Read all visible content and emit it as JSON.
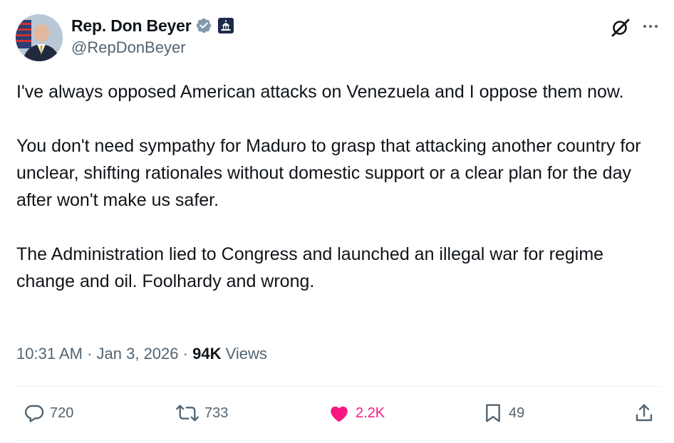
{
  "author": {
    "display_name": "Rep. Don Beyer",
    "handle": "@RepDonBeyer",
    "verified_badge_icon": "verified-badge-icon",
    "government_badge_icon": "capitol-building-icon",
    "verified_color": "#829aab"
  },
  "tweet": {
    "paragraphs": [
      "I've always opposed American attacks on Venezuela and I oppose them now.",
      "You don't need sympathy for Maduro to grasp that attacking another country for unclear, shifting rationales without domestic support or a clear plan for the day after won't make us safer.",
      "The Administration lied to Congress and launched an illegal war for regime change and oil. Foolhardy and wrong."
    ],
    "time": "10:31 AM",
    "separator": "·",
    "date": "Jan 3, 2026",
    "views_count": "94K",
    "views_label": "Views"
  },
  "actions": {
    "replies": "720",
    "reposts": "733",
    "likes": "2.2K",
    "bookmarks": "49"
  },
  "icons": {
    "grok": "grok-icon",
    "more": "more-icon",
    "reply": "reply-icon",
    "repost": "repost-icon",
    "like": "heart-icon",
    "bookmark": "bookmark-icon",
    "share": "share-icon"
  },
  "colors": {
    "text": "#0f1419",
    "secondary": "#536471",
    "like": "#f91880",
    "divider": "#eff3f4"
  }
}
